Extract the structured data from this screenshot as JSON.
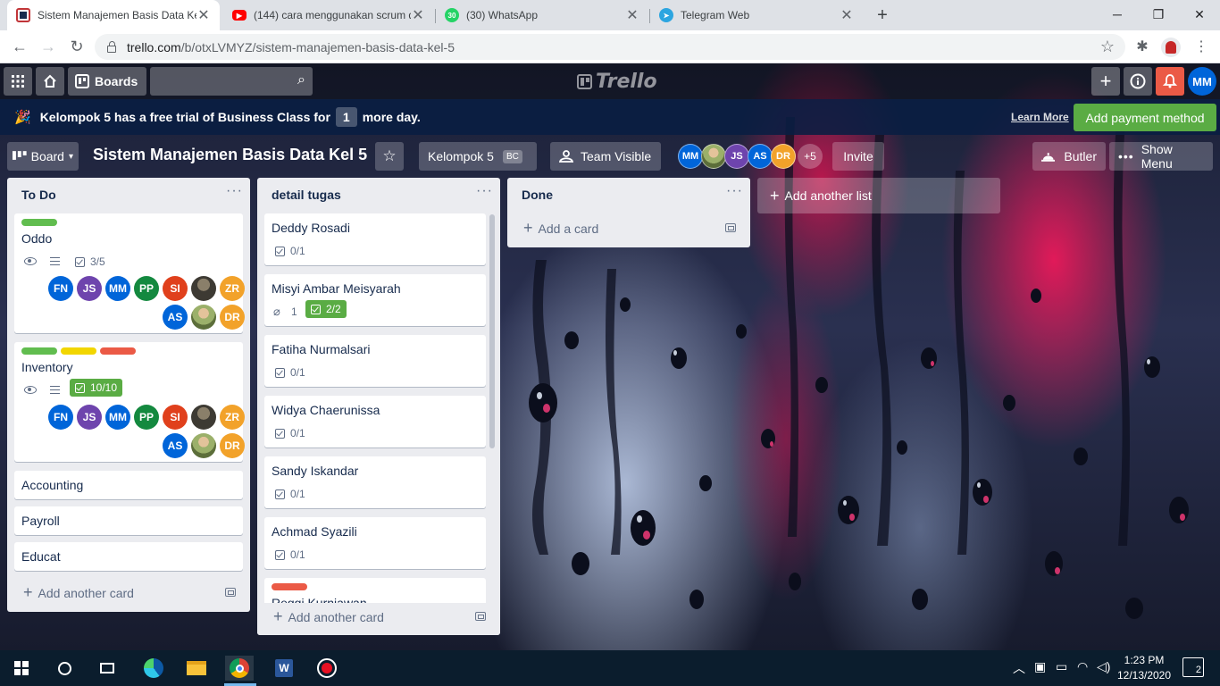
{
  "browser": {
    "tabs": [
      {
        "title": "Sistem Manajemen Basis Data Kel",
        "favicon": "trello-icon",
        "color": "#0079bf"
      },
      {
        "title": "(144) cara menggunakan scrum d",
        "favicon": "youtube-icon",
        "color": "#ff0000"
      },
      {
        "title": "(30) WhatsApp",
        "favicon": "whatsapp-icon",
        "color": "#25d366",
        "badge": "30"
      },
      {
        "title": "Telegram Web",
        "favicon": "telegram-icon",
        "color": "#2ca5e0"
      }
    ],
    "url_host": "trello.com",
    "url_path": "/b/otxLVMYZ/sistem-manajemen-basis-data-kel-5"
  },
  "trello_header": {
    "boards_label": "Boards",
    "logo_text": "Trello",
    "user_initials": "MM"
  },
  "banner": {
    "text_before": "Kelompok 5 has a free trial of Business Class for",
    "days": "1",
    "text_after": "more day.",
    "learn_more": "Learn More",
    "add_payment": "Add payment method"
  },
  "board_header": {
    "board_button": "Board",
    "title": "Sistem Manajemen Basis Data Kel 5",
    "team": "Kelompok 5",
    "team_badge": "BC",
    "visibility": "Team Visible",
    "members": [
      {
        "initials": "MM",
        "color": "#0065d9"
      },
      {
        "initials": "",
        "color": "#7a8b4a",
        "photo": true
      },
      {
        "initials": "JS",
        "color": "#6e44ad"
      },
      {
        "initials": "AS",
        "color": "#0065d9"
      },
      {
        "initials": "DR",
        "color": "#f2a22a"
      }
    ],
    "more_members": "+5",
    "invite": "Invite",
    "butler": "Butler",
    "show_menu": "Show Menu"
  },
  "lists": [
    {
      "title": "To Do",
      "cards": [
        {
          "title": "Oddo",
          "checklist": "3/5"
        },
        {
          "title": "Inventory",
          "checklist": "10/10"
        },
        {
          "title": "Accounting"
        },
        {
          "title": "Payroll"
        },
        {
          "title": "Educat"
        }
      ],
      "add_card": "Add another card"
    },
    {
      "title": "detail tugas",
      "cards": [
        {
          "title": "Deddy Rosadi",
          "checklist": "0/1"
        },
        {
          "title": "Misyi Ambar Meisyarah",
          "attachments": "1",
          "checklist": "2/2"
        },
        {
          "title": "Fatiha Nurmalsari",
          "checklist": "0/1"
        },
        {
          "title": "Widya Chaerunissa",
          "checklist": "0/1"
        },
        {
          "title": "Sandy Iskandar",
          "checklist": "0/1"
        },
        {
          "title": "Achmad Syazili",
          "checklist": "0/1"
        },
        {
          "title": "Reggi Kurniawan"
        }
      ],
      "add_card": "Add another card"
    },
    {
      "title": "Done",
      "cards": [],
      "add_card": "Add a card"
    }
  ],
  "add_list": "Add another list",
  "card_members": [
    {
      "initials": "FN",
      "color": "#0065d9"
    },
    {
      "initials": "JS",
      "color": "#6e44ad"
    },
    {
      "initials": "MM",
      "color": "#0065d9"
    },
    {
      "initials": "PP",
      "color": "#14893f"
    },
    {
      "initials": "SI",
      "color": "#e0401c"
    },
    {
      "initials": "",
      "color": "#3d3a33",
      "photo": true
    },
    {
      "initials": "ZR",
      "color": "#f2a22a"
    },
    {
      "initials": "AS",
      "color": "#0065d9"
    },
    {
      "initials": "",
      "color": "#9bb06a",
      "photo": true
    },
    {
      "initials": "DR",
      "color": "#f2a22a"
    }
  ],
  "label_colors": {
    "green": "#61bd4f",
    "yellow": "#f2d600",
    "red": "#eb5a46"
  },
  "taskbar": {
    "time": "1:23 PM",
    "date": "12/13/2020",
    "notifications": "2"
  }
}
